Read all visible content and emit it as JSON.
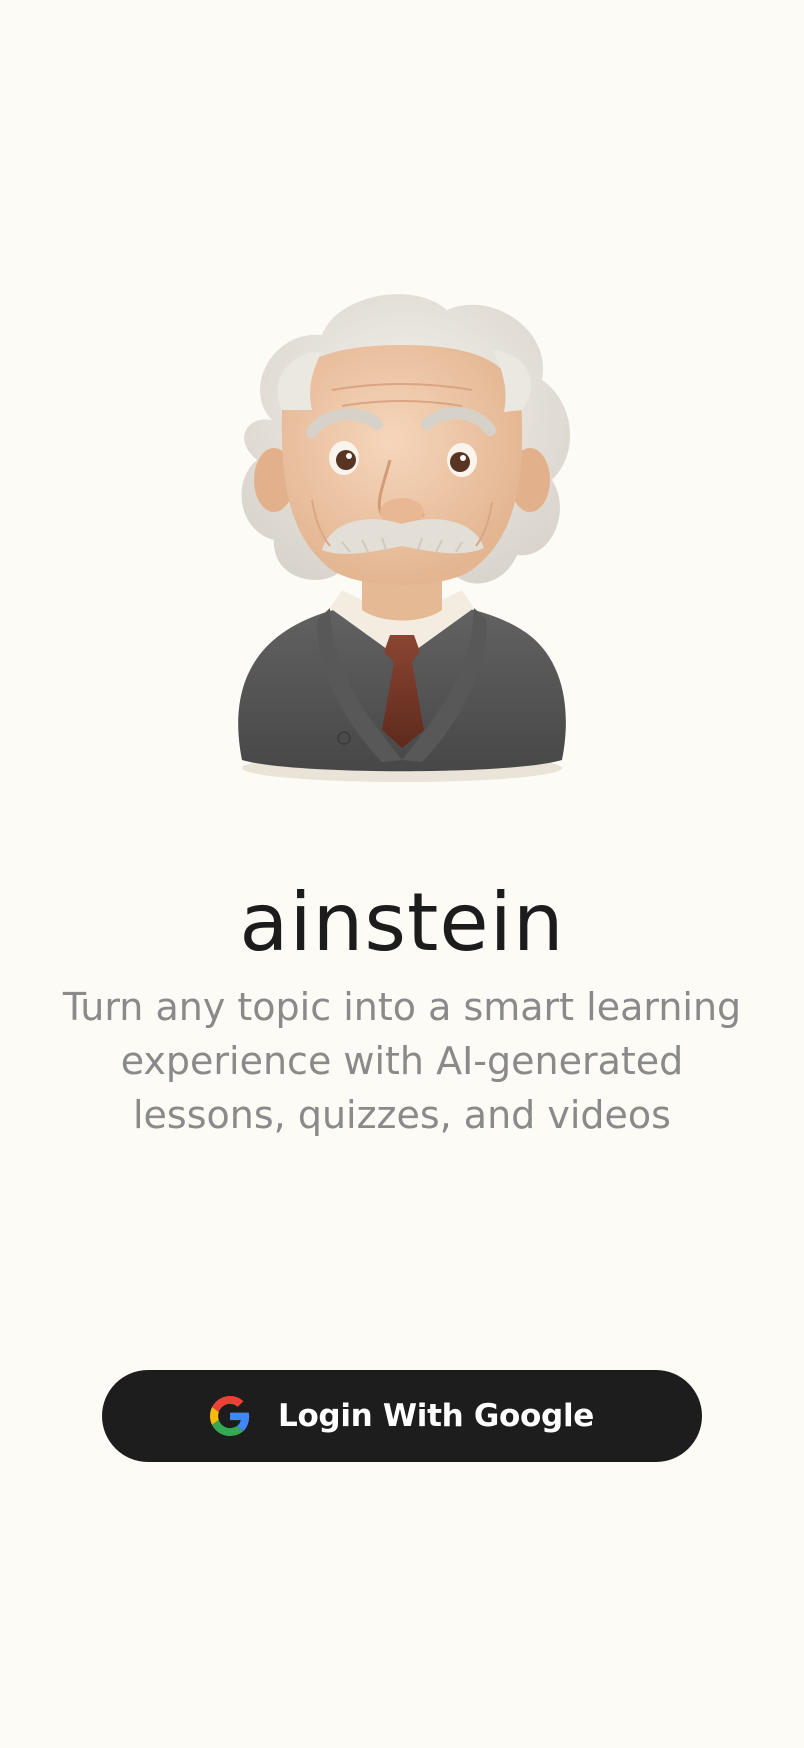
{
  "app": {
    "title": "ainstein",
    "tagline": "Turn any topic into a smart learning experience with AI-generated lessons, quizzes, and videos"
  },
  "login": {
    "label": "Login With Google",
    "icon": "google-icon"
  },
  "avatar": {
    "icon": "einstein-avatar"
  },
  "colors": {
    "background": "#fdfbf5",
    "title": "#1c1c1c",
    "tagline": "#8a8a8a",
    "button_bg": "#1d1d1d",
    "button_text": "#ffffff"
  }
}
